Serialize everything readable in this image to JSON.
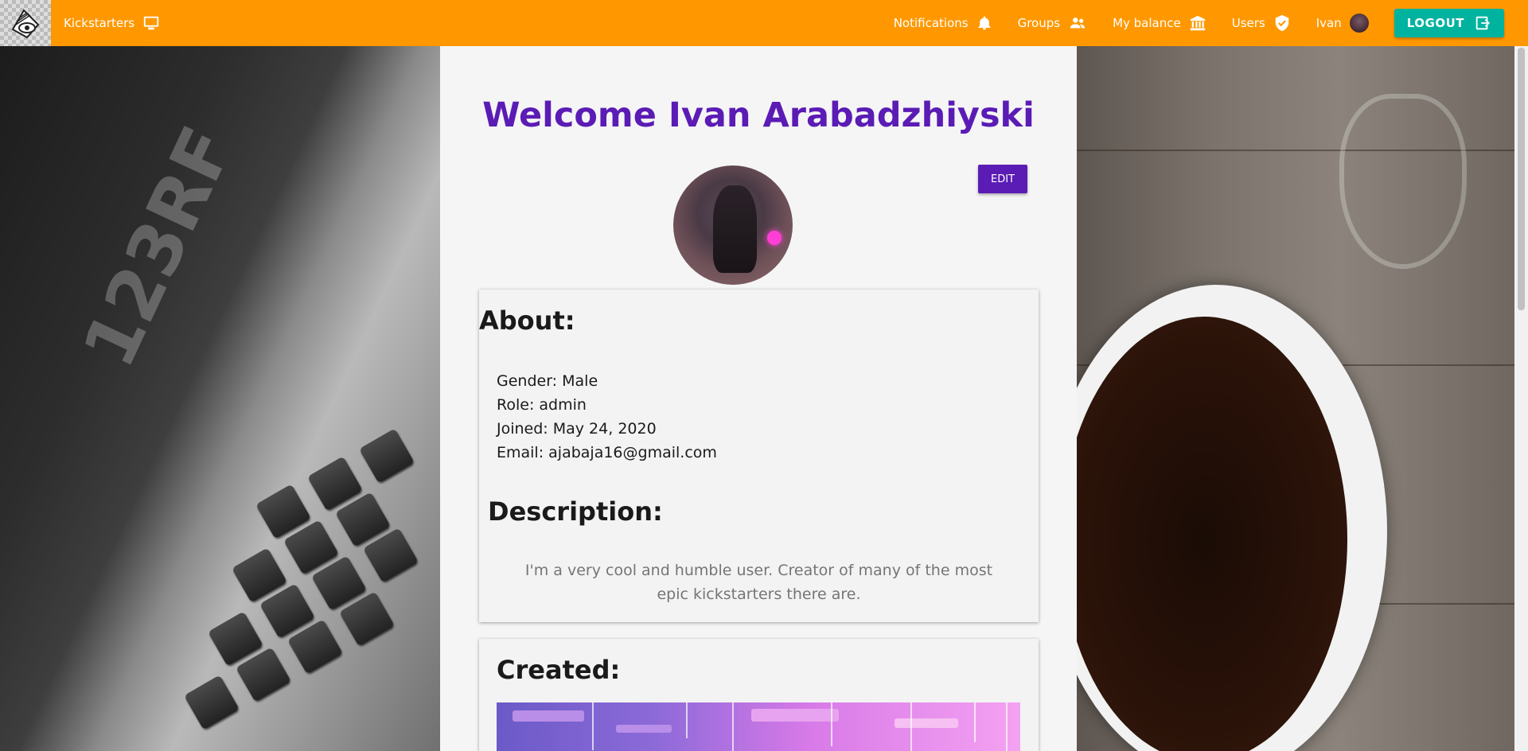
{
  "nav": {
    "kickstarters_label": "Kickstarters",
    "notifications_label": "Notifications",
    "groups_label": "Groups",
    "balance_label": "My balance",
    "users_label": "Users",
    "user_label": "Ivan",
    "logout_label": "LOGOUT"
  },
  "profile": {
    "welcome": "Welcome Ivan Arabadzhiyski",
    "edit_label": "EDIT",
    "about_heading": "About:",
    "gender": "Gender: Male",
    "role": "Role: admin",
    "joined": "Joined: May 24, 2020",
    "email": "Email: ajabaja16@gmail.com",
    "description_heading": "Description:",
    "description": "I'm a very cool and humble user. Creator of many of the most epic kickstarters there are.",
    "created_heading": "Created:"
  },
  "colors": {
    "topbar": "#ff9800",
    "accent": "#5b1bb5",
    "logout": "#00b39f"
  },
  "icons": {
    "kickstarters": "monitor-icon",
    "notifications": "bell-icon",
    "groups": "people-icon",
    "balance": "bank-icon",
    "users": "verified-shield-icon",
    "logout": "exit-icon"
  }
}
